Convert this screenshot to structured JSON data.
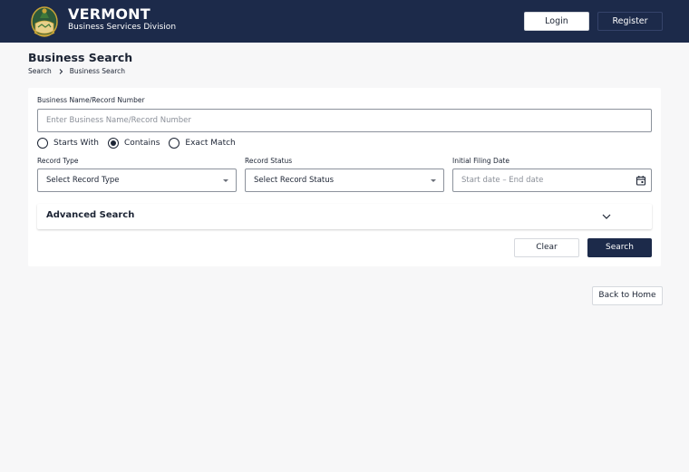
{
  "header": {
    "logo_icon": "vermont-seal-icon",
    "brand_title": "VERMONT",
    "brand_subtitle": "Business Services Division",
    "login_label": "Login",
    "register_label": "Register"
  },
  "page": {
    "title": "Business Search",
    "breadcrumb": [
      "Search",
      "Business Search"
    ]
  },
  "form": {
    "name_label": "Business Name/Record Number",
    "name_value": "",
    "name_placeholder": "Enter Business Name/Record Number",
    "match_options": [
      {
        "label": "Starts With",
        "checked": false
      },
      {
        "label": "Contains",
        "checked": true
      },
      {
        "label": "Exact Match",
        "checked": false
      }
    ],
    "record_type_label": "Record Type",
    "record_type_value": "Select Record Type",
    "record_status_label": "Record Status",
    "record_status_value": "Select Record Status",
    "filing_date_label": "Initial Filing Date",
    "filing_date_placeholder": "Start date – End date",
    "advanced_label": "Advanced Search",
    "clear_label": "Clear",
    "search_label": "Search"
  },
  "footer": {
    "back_label": "Back to Home"
  },
  "colors": {
    "navy": "#1c2a4a",
    "page_bg": "#f7f7f8",
    "card_bg": "#ffffff"
  }
}
